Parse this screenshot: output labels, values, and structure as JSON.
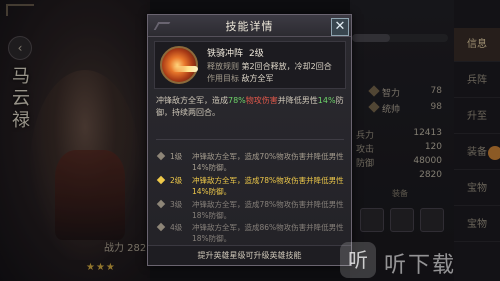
{
  "hero": {
    "name": "马云禄",
    "level_badge": "",
    "power_label": "战力 282",
    "stars": "★★★",
    "rank_text": "",
    "back_icon": "chevron-left-icon"
  },
  "stats": {
    "attributes": [
      {
        "label": "智力",
        "value": "78"
      },
      {
        "label": "统帅",
        "value": "98"
      }
    ],
    "numbers": [
      {
        "label": "兵力",
        "value": "12413"
      },
      {
        "label": "攻击",
        "value": "120"
      },
      {
        "label": "防御",
        "value": "48000"
      },
      {
        "label": "",
        "value": "2820"
      }
    ],
    "equip_title": "装备"
  },
  "tabs": [
    {
      "label": "信息",
      "active": true
    },
    {
      "label": "兵阵",
      "active": false
    },
    {
      "label": "升至",
      "active": false
    },
    {
      "label": "装备",
      "active": false
    },
    {
      "label": "宝物",
      "active": false
    },
    {
      "label": "宝物",
      "active": false
    }
  ],
  "dialog": {
    "title": "技能详情",
    "close_icon": "close-icon",
    "skill": {
      "name": "铁骑冲阵",
      "level": "2级",
      "release_label": "释放规则",
      "release_value": "第2回合释放，冷却2回合",
      "target_label": "作用目标",
      "target_value": "敌方全军"
    },
    "description": {
      "p1": "冲锋敌方全军，造成",
      "pct": "78%",
      "p2": "物攻伤害",
      "p3": "并降低男性",
      "def": "14%",
      "p4": "防御，持续两回合。"
    },
    "levels": [
      {
        "level": "1级",
        "text": "冲锋敌方全军，造成70%物攻伤害并降低男性14%防御。",
        "state": "normal"
      },
      {
        "level": "2级",
        "text": "冲锋敌方全军，造成78%物攻伤害并降低男性14%防御。",
        "state": "current"
      },
      {
        "level": "3级",
        "text": "冲锋敌方全军，造成78%物攻伤害并降低男性18%防御。",
        "state": "locked"
      },
      {
        "level": "4级",
        "text": "冲锋敌方全军，造成86%物攻伤害并降低男性18%防御。",
        "state": "locked"
      }
    ],
    "footer": "提升英雄星级可升级英雄技能"
  },
  "watermark": {
    "icon_char": "听",
    "text": "听下载"
  }
}
